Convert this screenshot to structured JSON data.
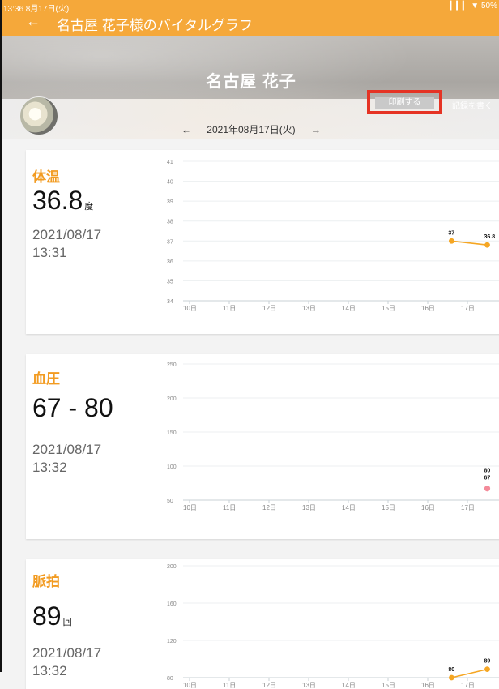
{
  "status_bar": {
    "left": "13:36  8月17日(火)",
    "right": "▎▎▎ ▼ 50%"
  },
  "header": {
    "title": "名古屋 花子様のバイタルグラフ",
    "back": "←"
  },
  "hero": {
    "name": "名古屋 花子",
    "print_label": "印刷する",
    "write_label": "記録を書く"
  },
  "date_nav": {
    "prev": "←",
    "date": "2021年08月17日(火)",
    "next": "→"
  },
  "x_ticks": [
    "10日",
    "11日",
    "12日",
    "13日",
    "14日",
    "15日",
    "16日",
    "17日"
  ],
  "vitals": [
    {
      "label": "体温",
      "value": "36.8",
      "unit": "度",
      "date": "2021/08/17",
      "time": "13:31"
    },
    {
      "label": "血圧",
      "value": "67 - 80",
      "unit": "",
      "date": "2021/08/17",
      "time": "13:32"
    },
    {
      "label": "脈拍",
      "value": "89",
      "unit": "回",
      "date": "2021/08/17",
      "time": "13:32"
    }
  ],
  "chart_data": [
    {
      "type": "line",
      "x": [
        "10日",
        "11日",
        "12日",
        "13日",
        "14日",
        "15日",
        "16日",
        "17日"
      ],
      "ylim": [
        34,
        41
      ],
      "yticks": [
        34,
        35,
        36,
        37,
        38,
        39,
        40,
        41
      ],
      "series": [
        {
          "values": [
            null,
            null,
            null,
            null,
            null,
            null,
            37,
            36.8
          ],
          "color": "#f5a623"
        }
      ],
      "point_labels": [
        "37",
        "36.8"
      ]
    },
    {
      "type": "scatter",
      "x": [
        "10日",
        "11日",
        "12日",
        "13日",
        "14日",
        "15日",
        "16日",
        "17日"
      ],
      "ylim": [
        50,
        250
      ],
      "yticks": [
        50,
        100,
        150,
        200,
        250
      ],
      "series": [
        {
          "values": [
            null,
            null,
            null,
            null,
            null,
            null,
            null,
            null
          ],
          "color": "#f48b9a"
        }
      ],
      "point_labels": [
        "80",
        "67"
      ]
    },
    {
      "type": "line",
      "x": [
        "10日",
        "11日",
        "12日",
        "13日",
        "14日",
        "15日",
        "16日",
        "17日"
      ],
      "ylim": [
        80,
        200
      ],
      "yticks": [
        80,
        120,
        160,
        200
      ],
      "series": [
        {
          "values": [
            null,
            null,
            null,
            null,
            null,
            null,
            80,
            89
          ],
          "color": "#f5a623"
        }
      ],
      "point_labels": [
        "80",
        "89"
      ]
    }
  ]
}
